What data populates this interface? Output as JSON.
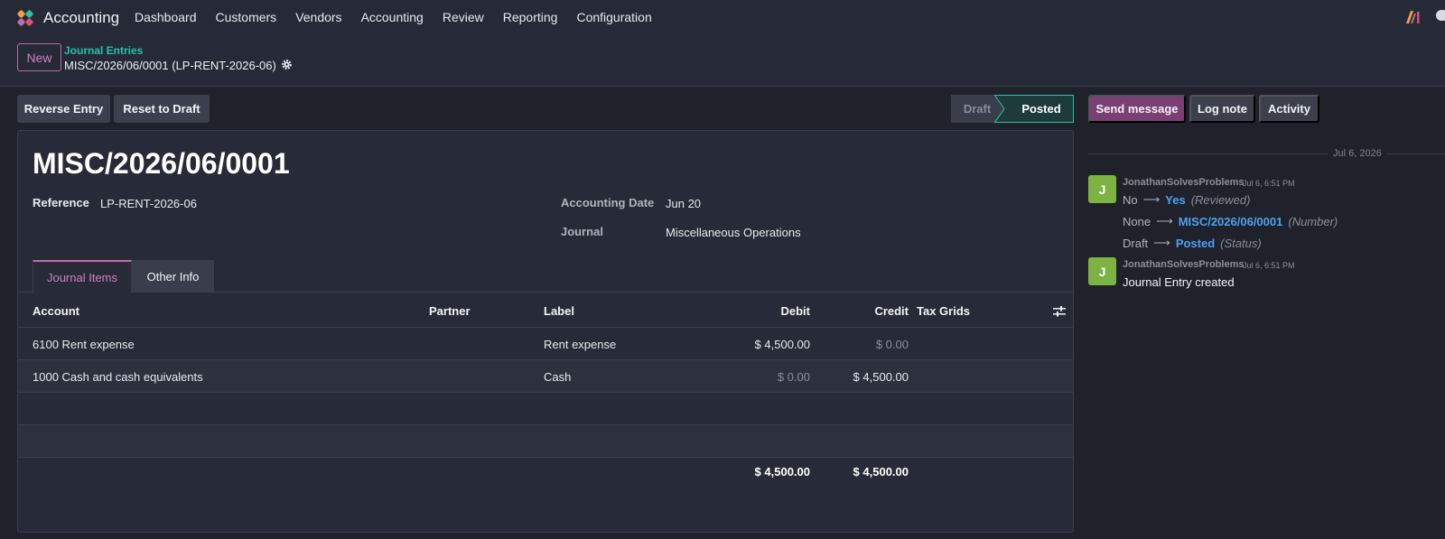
{
  "app": {
    "name": "Accounting",
    "menu": [
      "Dashboard",
      "Customers",
      "Vendors",
      "Accounting",
      "Review",
      "Reporting",
      "Configuration"
    ]
  },
  "breadcrumb": {
    "new_label": "New",
    "parent": "Journal Entries",
    "current": "MISC/2026/06/0001 (LP-RENT-2026-06)"
  },
  "actions": {
    "reverse": "Reverse Entry",
    "reset": "Reset to Draft"
  },
  "status": {
    "draft": "Draft",
    "posted": "Posted",
    "active": "posted"
  },
  "entry": {
    "title": "MISC/2026/06/0001",
    "reference_label": "Reference",
    "reference": "LP-RENT-2026-06",
    "date_label": "Accounting Date",
    "date": "Jun 20",
    "journal_label": "Journal",
    "journal": "Miscellaneous Operations"
  },
  "tabs": [
    "Journal Items",
    "Other Info"
  ],
  "table": {
    "headers": {
      "account": "Account",
      "partner": "Partner",
      "label": "Label",
      "debit": "Debit",
      "credit": "Credit",
      "tax": "Tax Grids"
    },
    "rows": [
      {
        "account": "6100 Rent expense",
        "partner": "",
        "label": "Rent expense",
        "debit": "$ 4,500.00",
        "credit": "$ 0.00"
      },
      {
        "account": "1000 Cash and cash equivalents",
        "partner": "",
        "label": "Cash",
        "debit": "$ 0.00",
        "credit": "$ 4,500.00"
      }
    ],
    "total_debit": "$ 4,500.00",
    "total_credit": "$ 4,500.00"
  },
  "chatter": {
    "send_message": "Send message",
    "log_note": "Log note",
    "activity": "Activity",
    "date_separator": "Jul 6, 2026",
    "messages": [
      {
        "avatar": "J",
        "author": "JonathanSolvesProblems",
        "time": "Jul 6, 6:51 PM",
        "tracking": [
          {
            "old": "No",
            "new": "Yes",
            "field": "(Reviewed)"
          },
          {
            "old": "None",
            "new": "MISC/2026/06/0001",
            "field": "(Number)"
          },
          {
            "old": "Draft",
            "new": "Posted",
            "field": "(Status)"
          }
        ]
      },
      {
        "avatar": "J",
        "author": "JonathanSolvesProblems",
        "time": "Jul 6, 6:51 PM",
        "body": "Journal Entry created"
      }
    ]
  },
  "colors": {
    "accent": "#27c2a8",
    "brand_pink": "#c06bb0",
    "primary_button": "#7b3f74",
    "avatar": "#7cb342",
    "link": "#4ea1f3"
  }
}
